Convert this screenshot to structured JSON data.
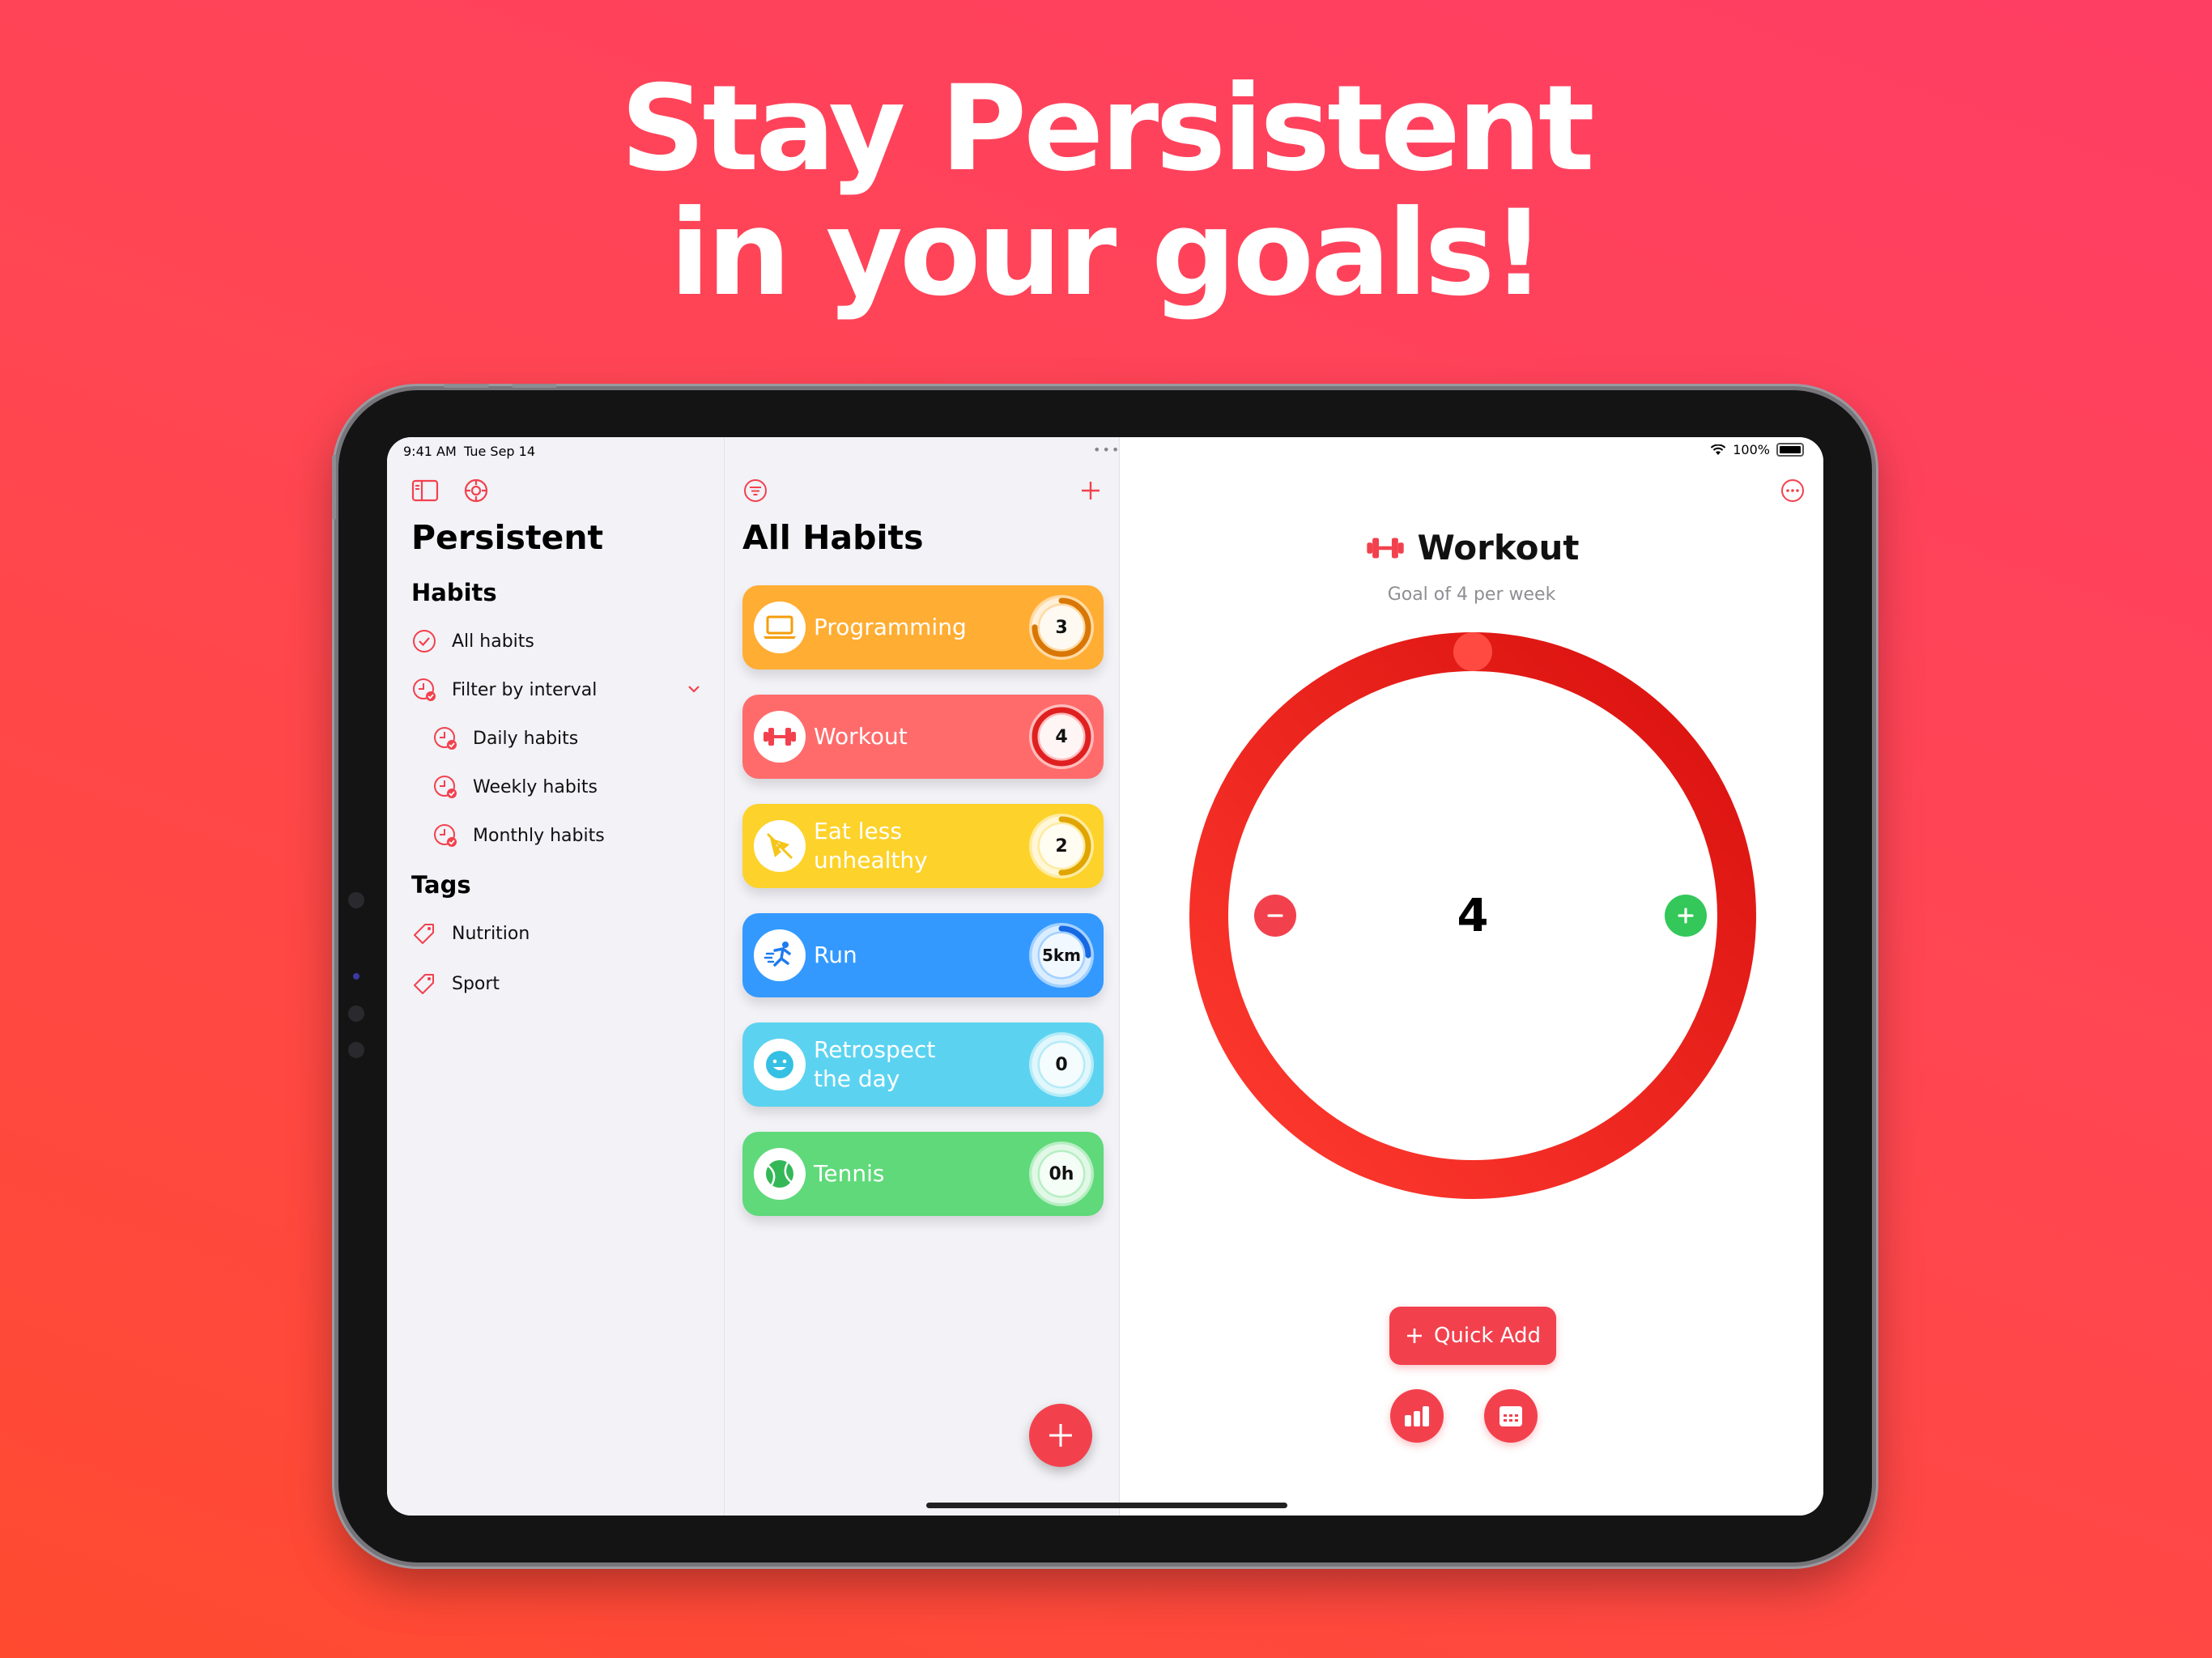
{
  "headline": {
    "line1": "Stay Persistent",
    "line2": "in your goals!"
  },
  "status_bar": {
    "time": "9:41 AM",
    "date": "Tue Sep 14",
    "battery": "100%"
  },
  "sidebar": {
    "app_title": "Persistent",
    "habits_section": "Habits",
    "items": [
      {
        "label": "All habits",
        "icon": "checkmark-circle-icon"
      },
      {
        "label": "Filter by interval",
        "icon": "clock-icon"
      },
      {
        "label": "Daily habits",
        "icon": "clock-icon"
      },
      {
        "label": "Weekly habits",
        "icon": "clock-icon"
      },
      {
        "label": "Monthly habits",
        "icon": "clock-icon"
      }
    ],
    "tags_section": "Tags",
    "tags": [
      {
        "label": "Nutrition",
        "icon": "tag-icon"
      },
      {
        "label": "Sport",
        "icon": "tag-icon"
      }
    ]
  },
  "habit_list": {
    "title": "All Habits",
    "habits": [
      {
        "name": "Programming",
        "count": "3",
        "progress": 0.75,
        "icon": "laptop-icon",
        "color": "#ffad33",
        "ring_color": "#d97706"
      },
      {
        "name": "Workout",
        "count": "4",
        "progress": 1.0,
        "icon": "dumbbell-icon",
        "color": "#ff6b6b",
        "ring_color": "#e02020"
      },
      {
        "name": "Eat less unhealthy",
        "count": "2",
        "progress": 0.5,
        "icon": "no-pizza-icon",
        "color": "#fdd22a",
        "ring_color": "#e0a500"
      },
      {
        "name": "Run",
        "count": "5km",
        "progress": 0.25,
        "icon": "runner-icon",
        "color": "#3399ff",
        "ring_color": "#1668e3"
      },
      {
        "name": "Retrospect the day",
        "count": "0",
        "progress": 0.0,
        "icon": "smiley-icon",
        "color": "#5bd3f0",
        "ring_color": "#1aa8cc"
      },
      {
        "name": "Tennis",
        "count": "0h",
        "progress": 0.0,
        "icon": "tennis-ball-icon",
        "color": "#5fd97a",
        "ring_color": "#2fb24f"
      }
    ]
  },
  "detail": {
    "title": "Workout",
    "subtitle": "Goal of 4 per week",
    "count": "4",
    "progress": 1.0,
    "quick_add_label": "Quick Add"
  },
  "colors": {
    "accent": "#f2414d",
    "ring_dark": "#d9100e",
    "ring_light": "#ff3b30",
    "plus_green": "#34c759"
  }
}
